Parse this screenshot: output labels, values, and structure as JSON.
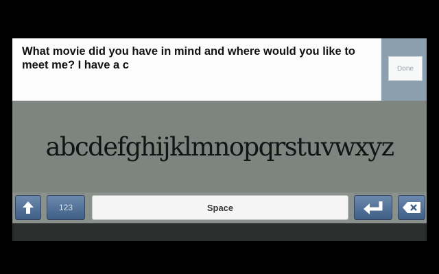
{
  "text_entry": {
    "value": "What movie did you have in mind and where would you like to meet me? I have a c"
  },
  "done_button": {
    "label": "Done"
  },
  "letter_strip": {
    "letters": "abcdefghijklmnopqrstuvwxyz"
  },
  "keys": {
    "shift_icon": "up-arrow-icon",
    "numbers_label": "123",
    "space_label": "Space",
    "enter_icon": "return-arrow-icon",
    "backspace_icon": "backspace-icon"
  },
  "colors": {
    "text_background": "#fbfcfb",
    "letter_strip_background": "#7e8581",
    "key_blue": "#4f6f97",
    "done_panel": "#8c9fb0"
  }
}
